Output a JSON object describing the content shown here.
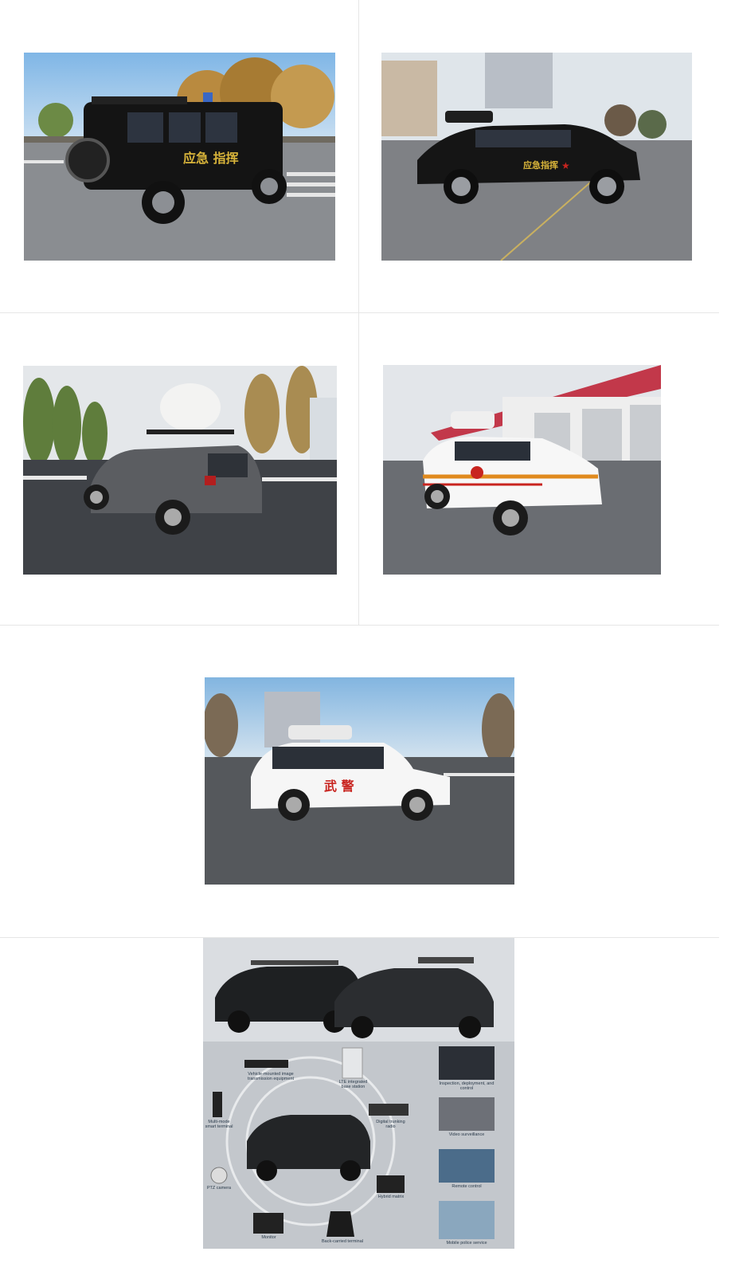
{
  "gallery": {
    "images": [
      {
        "id": "p1",
        "plate_text": "应急 指挥",
        "accent": "#d8b43a"
      },
      {
        "id": "p2",
        "plate_text": "应急指挥",
        "accent": "#d8b43a"
      },
      {
        "id": "p3",
        "plate_text": ""
      },
      {
        "id": "p4",
        "plate_text": ""
      },
      {
        "id": "p5",
        "plate_text": "武   警",
        "accent": "#c8241f"
      }
    ],
    "diagram": {
      "labels": {
        "vehicle_transmission": "Vehicle-mounted image transmission equipment",
        "lte_base": "LTE integrated base station",
        "inspection": "Inspection, deployment, and control",
        "multimode": "Multi-mode smart terminal",
        "trunking": "Digital trunking radio",
        "video": "Video surveillance",
        "ptz": "PTZ camera",
        "hybrid": "Hybrid matrix",
        "remote": "Remote control",
        "monitor": "Monitor",
        "backcarried": "Back-carried terminal",
        "mobile_police": "Mobile police service"
      }
    }
  }
}
